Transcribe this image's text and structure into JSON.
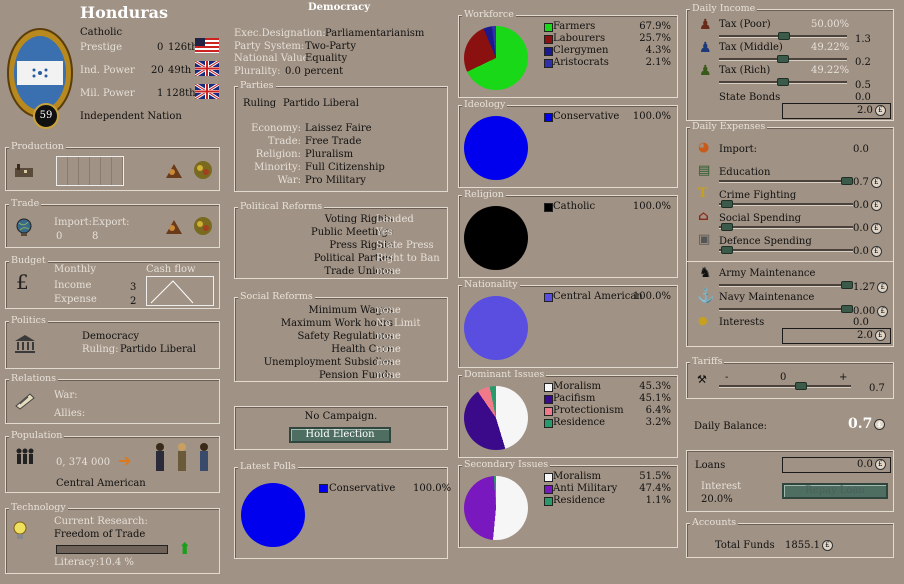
{
  "country": {
    "name": "Honduras",
    "religion": "Catholic",
    "rank_badge": "59",
    "status": "Independent Nation",
    "prestige": {
      "label": "Prestige",
      "value": "0",
      "rank": "126th"
    },
    "ind_power": {
      "label": "Ind. Power",
      "value": "20",
      "rank": "49th"
    },
    "mil_power": {
      "label": "Mil. Power",
      "value": "1",
      "rank": "128th"
    }
  },
  "production": {
    "title": "Production"
  },
  "trade": {
    "title": "Trade",
    "import_label": "Import:",
    "export_label": "Export:",
    "import_value": "0",
    "export_value": "8"
  },
  "budget": {
    "title": "Budget",
    "monthly_label": "Monthly",
    "cashflow_label": "Cash flow",
    "income_label": "Income",
    "income_value": "3",
    "expense_label": "Expense",
    "expense_value": "2"
  },
  "politics": {
    "title": "Politics",
    "government": "Democracy",
    "ruling_label": "Ruling:",
    "ruling_party": "Partido Liberal"
  },
  "relations": {
    "title": "Relations",
    "war_label": "War:",
    "allies_label": "Allies:"
  },
  "population": {
    "title": "Population",
    "count": "0, 374 000",
    "culture": "Central American"
  },
  "technology": {
    "title": "Technology",
    "current_label": "Current Research:",
    "current": "Freedom of Trade",
    "literacy_label": "Literacy:",
    "literacy_value": "10.4 %",
    "progress": 0.0
  },
  "government": {
    "title": "Democracy",
    "rows": [
      {
        "label": "Exec.Designation:",
        "value": "Parliamentarianism"
      },
      {
        "label": "Party System:",
        "value": "Two-Party"
      },
      {
        "label": "National Value:",
        "value": "Equality"
      },
      {
        "label": "Plurality:",
        "value": "0.0 percent"
      }
    ]
  },
  "parties": {
    "title": "Parties",
    "ruling_label": "Ruling",
    "ruling": "Partido Liberal",
    "rows": [
      {
        "label": "Economy:",
        "value": "Laissez Faire"
      },
      {
        "label": "Trade:",
        "value": "Free Trade"
      },
      {
        "label": "Religion:",
        "value": "Pluralism"
      },
      {
        "label": "Minority:",
        "value": "Full Citizenship"
      },
      {
        "label": "War:",
        "value": "Pro Military"
      }
    ]
  },
  "political_reforms": {
    "title": "Political Reforms",
    "rows": [
      {
        "label": "Voting Rights",
        "value": "Landed"
      },
      {
        "label": "Public Meetings",
        "value": "Yes"
      },
      {
        "label": "Press Rights",
        "value": "State Press"
      },
      {
        "label": "Political Parties",
        "value": "Right to Ban"
      },
      {
        "label": "Trade Unions",
        "value": "none"
      }
    ]
  },
  "social_reforms": {
    "title": "Social Reforms",
    "rows": [
      {
        "label": "Minimum Wages",
        "value": "none"
      },
      {
        "label": "Maximum Work hours",
        "value": "No Limit"
      },
      {
        "label": "Safety Regulations",
        "value": "none"
      },
      {
        "label": "Health Care",
        "value": "none"
      },
      {
        "label": "Unemployment Subsidies",
        "value": "none"
      },
      {
        "label": "Pension Funds",
        "value": "none"
      }
    ]
  },
  "campaign": {
    "status": "No Campaign.",
    "button": "Hold Election"
  },
  "latest_polls": {
    "title": "Latest Polls",
    "items": [
      {
        "name": "Conservative",
        "value": "100.0%",
        "color": "#0000ee"
      }
    ]
  },
  "workforce": {
    "title": "Workforce",
    "items": [
      {
        "name": "Farmers",
        "value": "67.9%",
        "color": "#18d818"
      },
      {
        "name": "Labourers",
        "value": "25.7%",
        "color": "#8b1010"
      },
      {
        "name": "Clergymen",
        "value": "4.3%",
        "color": "#1a1a8c"
      },
      {
        "name": "Aristocrats",
        "value": "2.1%",
        "color": "#3030a8"
      }
    ]
  },
  "ideology": {
    "title": "Ideology",
    "items": [
      {
        "name": "Conservative",
        "value": "100.0%",
        "color": "#0000ee"
      }
    ]
  },
  "religion_panel": {
    "title": "Religion",
    "items": [
      {
        "name": "Catholic",
        "value": "100.0%",
        "color": "#000000"
      }
    ]
  },
  "nationality": {
    "title": "Nationality",
    "items": [
      {
        "name": "Central American",
        "value": "100.0%",
        "color": "#5a4ee0"
      }
    ]
  },
  "dominant_issues": {
    "title": "Dominant Issues",
    "items": [
      {
        "name": "Moralism",
        "value": "45.3%",
        "color": "#f6f6f6"
      },
      {
        "name": "Pacifism",
        "value": "45.1%",
        "color": "#3a0a8a"
      },
      {
        "name": "Protectionism",
        "value": "6.4%",
        "color": "#f07a8a"
      },
      {
        "name": "Residence",
        "value": "3.2%",
        "color": "#2a9a6a"
      }
    ]
  },
  "secondary_issues": {
    "title": "Secondary Issues",
    "items": [
      {
        "name": "Moralism",
        "value": "51.5%",
        "color": "#f6f6f6"
      },
      {
        "name": "Anti Military",
        "value": "47.4%",
        "color": "#7a18c0"
      },
      {
        "name": "Residence",
        "value": "1.1%",
        "color": "#2a9a6a"
      }
    ]
  },
  "daily_income": {
    "title": "Daily Income",
    "taxes": [
      {
        "label": "Tax (Poor)",
        "pct": "50.00%",
        "value": "1.3"
      },
      {
        "label": "Tax (Middle)",
        "pct": "49.22%",
        "value": "0.2"
      },
      {
        "label": "Tax (Rich)",
        "pct": "49.22%",
        "value": "0.5"
      }
    ],
    "bonds_label": "State Bonds",
    "bonds_value": "0.0",
    "total": "2.0"
  },
  "daily_expenses": {
    "title": "Daily Expenses",
    "items": [
      {
        "label": "Import:",
        "value": "0.0"
      },
      {
        "label": "Education",
        "value": "0.7"
      },
      {
        "label": "Crime Fighting",
        "value": "0.0"
      },
      {
        "label": "Social Spending",
        "value": "0.0"
      },
      {
        "label": "Defence Spending",
        "value": "0.0"
      }
    ],
    "army_label": "Army Maintenance",
    "army_value": "1.27",
    "navy_label": "Navy Maintenance",
    "navy_value": "0.00",
    "interests_label": "Interests",
    "interests_value": "0.0",
    "total": "2.0"
  },
  "tariffs": {
    "title": "Tariffs",
    "minus": "-",
    "plus": "+",
    "center": "0",
    "value": "0.7"
  },
  "balance": {
    "label": "Daily Balance:",
    "value": "0.7"
  },
  "loans": {
    "label": "Loans",
    "value": "0.0",
    "interest_label": "Interest",
    "interest_value": "20.0%",
    "button": "Repay Loan"
  },
  "accounts": {
    "title": "Accounts",
    "funds_label": "Total Funds",
    "funds_value": "1855.1"
  },
  "currency_symbol": "£"
}
